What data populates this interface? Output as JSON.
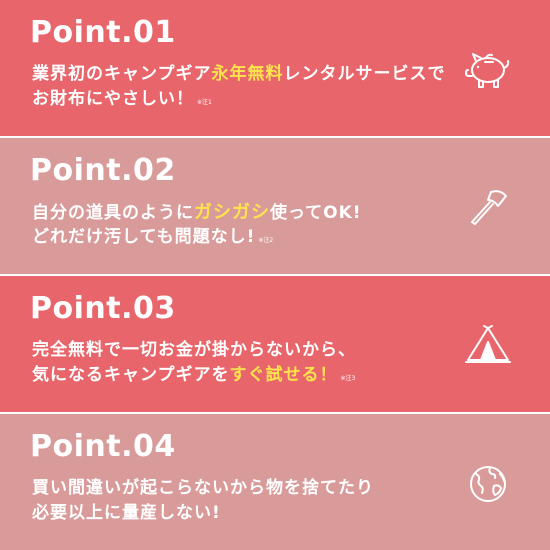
{
  "colors": {
    "panel_dark": "#e8666b",
    "panel_light": "#d99a9a",
    "highlight": "#ffe34d",
    "text": "#ffffff"
  },
  "points": [
    {
      "title": "Point.01",
      "line1_a": "業界初のキャンプギア",
      "line1_hl": "永年無料",
      "line1_b": "レンタルサービスで",
      "line2_a": "お財布にやさしい！",
      "note": "※注1",
      "icon": "piggy-bank-icon"
    },
    {
      "title": "Point.02",
      "line1_a": "自分の道具のように",
      "line1_hl": "ガシガシ",
      "line1_b": "使ってOK!",
      "line2_a": "どれだけ汚しても問題なし!",
      "note": "※注2",
      "icon": "axe-icon"
    },
    {
      "title": "Point.03",
      "line1_a": "完全無料で一切お金が掛からないから、",
      "line2_a": "気になるキャンプギアを",
      "line2_hl": "すぐ試せる！",
      "note": "※注3",
      "icon": "tent-icon"
    },
    {
      "title": "Point.04",
      "line1_a": "買い間違いが起こらないから物を捨てたり",
      "line2_a": "必要以上に量産しない!",
      "icon": "globe-icon"
    }
  ]
}
